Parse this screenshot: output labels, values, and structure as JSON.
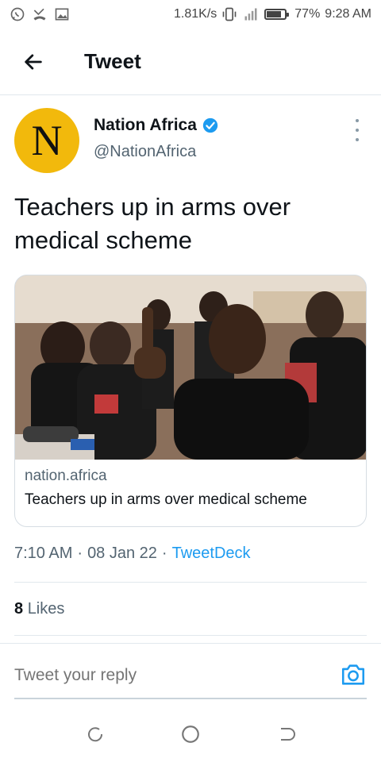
{
  "status_bar": {
    "network_speed": "1.81K/s",
    "battery_percent": "77%",
    "time": "9:28 AM",
    "icons": [
      "whatsapp-icon",
      "missed-call-icon",
      "gallery-icon",
      "vibrate-icon",
      "signal-icon",
      "battery-icon"
    ]
  },
  "app_bar": {
    "title": "Tweet"
  },
  "author": {
    "avatar_letter": "N",
    "avatar_color": "#f2b90c",
    "name": "Nation Africa",
    "handle": "@NationAfrica",
    "verified": true
  },
  "tweet": {
    "text": "Teachers up in arms over medical scheme",
    "card": {
      "domain": "nation.africa",
      "title": "Teachers up in arms over medical scheme"
    },
    "time": "7:10 AM",
    "date": "08 Jan 22",
    "source": "TweetDeck",
    "separator": "·",
    "likes_count": "8",
    "likes_label": "Likes"
  },
  "reply": {
    "placeholder": "Tweet your reply"
  },
  "colors": {
    "accent": "#1d9bf0",
    "text_primary": "#0f1419",
    "text_secondary": "#536471"
  }
}
